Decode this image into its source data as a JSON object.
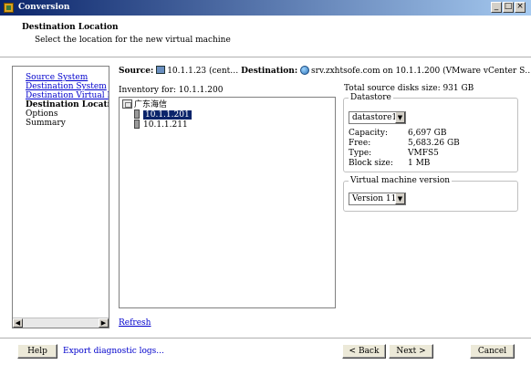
{
  "window": {
    "title": "Conversion",
    "controls": [
      "_",
      "□",
      "×"
    ]
  },
  "header": {
    "title": "Destination Location",
    "subtitle": "Select the location for the new virtual machine"
  },
  "steps": [
    {
      "label": "Source System",
      "state": "link"
    },
    {
      "label": "Destination System",
      "state": "link"
    },
    {
      "label": "Destination Virtual M",
      "state": "link"
    },
    {
      "label": "Destination Locati",
      "state": "current"
    },
    {
      "label": "Options",
      "state": "normal"
    },
    {
      "label": "Summary",
      "state": "normal"
    }
  ],
  "source_line": {
    "source_label": "Source:",
    "source_value": "10.1.1.23 (cent…",
    "dest_label": "Destination:",
    "dest_value": "srv.zxhtsofe.com on 10.1.1.200 (VMware vCenter S…"
  },
  "inventory": {
    "label": "Inventory for: 10.1.1.200",
    "datacenter": "广东海信",
    "hosts": [
      {
        "name": "10.1.1.201",
        "selected": true
      },
      {
        "name": "10.1.1.211",
        "selected": false
      }
    ],
    "refresh_label": "Refresh"
  },
  "disks": {
    "total_label": "Total source disks size: 931 GB"
  },
  "datastore": {
    "legend": "Datastore",
    "selected": "datastore1",
    "fields": [
      {
        "key": "Capacity:",
        "value": "6,697 GB"
      },
      {
        "key": "Free:",
        "value": "5,683.26 GB"
      },
      {
        "key": "Type:",
        "value": "VMFS5"
      },
      {
        "key": "Block size:",
        "value": "1 MB"
      }
    ]
  },
  "vm_version": {
    "legend": "Virtual machine version",
    "selected": "Version 11"
  },
  "footer": {
    "help": "Help",
    "export": "Export diagnostic logs...",
    "back": "< Back",
    "next": "Next >",
    "cancel": "Cancel"
  },
  "icons": {
    "scroll_left": "◀",
    "scroll_right": "▶",
    "dropdown": "▼"
  }
}
